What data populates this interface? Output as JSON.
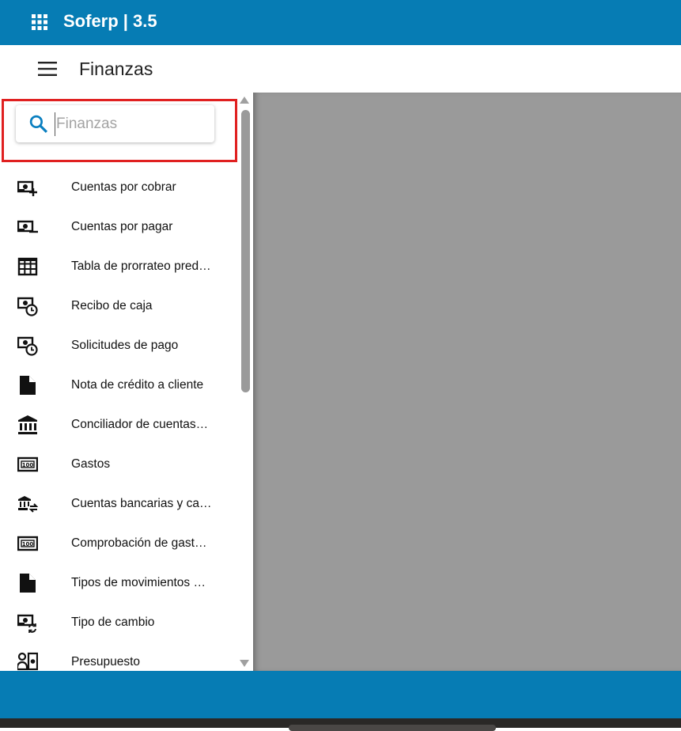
{
  "app": {
    "title": "Soferp | 3.5",
    "apps_icon": "apps-grid-icon",
    "brand_color": "#067cb4"
  },
  "header": {
    "section_title": "Finanzas",
    "menu_icon": "hamburger-menu-icon"
  },
  "search": {
    "placeholder": "Finanzas",
    "value": "",
    "icon": "search-icon",
    "highlight_color": "#e02020"
  },
  "sidebar": {
    "items": [
      {
        "label": "Cuentas por cobrar",
        "icon": "money-plus-icon"
      },
      {
        "label": "Cuentas por pagar",
        "icon": "money-minus-icon"
      },
      {
        "label": "Tabla de prorrateo pred…",
        "icon": "table-grid-icon"
      },
      {
        "label": "Recibo de caja",
        "icon": "money-clock-icon"
      },
      {
        "label": "Solicitudes de pago",
        "icon": "money-clock-icon"
      },
      {
        "label": "Nota de crédito a cliente",
        "icon": "document-icon"
      },
      {
        "label": "Conciliador de cuentas…",
        "icon": "bank-icon"
      },
      {
        "label": "Gastos",
        "icon": "banknote-100-icon"
      },
      {
        "label": "Cuentas bancarias y ca…",
        "icon": "bank-transfer-icon"
      },
      {
        "label": "Comprobación de gast…",
        "icon": "banknote-100-icon"
      },
      {
        "label": "Tipos de movimientos …",
        "icon": "document-icon"
      },
      {
        "label": "Tipo de cambio",
        "icon": "money-sync-icon"
      },
      {
        "label": "Presupuesto",
        "icon": "person-money-icon"
      }
    ]
  },
  "main": {
    "background_color": "#9a9a9a"
  }
}
